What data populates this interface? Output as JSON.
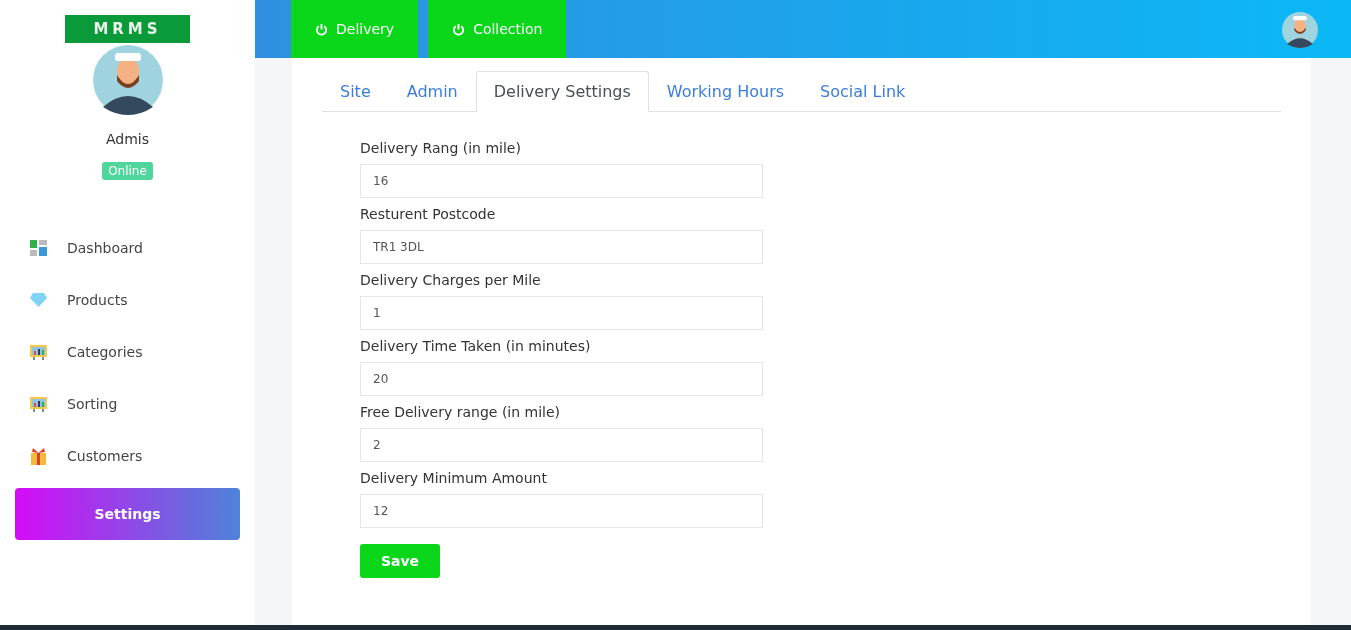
{
  "sidebar": {
    "logo": "MRMS",
    "user": {
      "name": "Admis",
      "status": "Online"
    },
    "items": [
      {
        "label": "Dashboard",
        "kind": "dashboard",
        "selected": false
      },
      {
        "label": "Products",
        "kind": "gem",
        "selected": false
      },
      {
        "label": "Categories",
        "kind": "chart",
        "selected": false
      },
      {
        "label": "Sorting",
        "kind": "chart",
        "selected": false
      },
      {
        "label": "Customers",
        "kind": "gift",
        "selected": false
      },
      {
        "label": "Settings",
        "selected": true
      }
    ]
  },
  "topbar": {
    "toggles": [
      {
        "label": "Delivery",
        "on": true
      },
      {
        "label": "Collection",
        "on": true
      }
    ]
  },
  "tabs": [
    {
      "label": "Site",
      "selected": false
    },
    {
      "label": "Admin",
      "selected": false
    },
    {
      "label": "Delivery Settings",
      "selected": true
    },
    {
      "label": "Working Hours",
      "selected": false
    },
    {
      "label": "Social Link",
      "selected": false
    }
  ],
  "form": {
    "fields": [
      {
        "label": "Delivery Rang (in mile)",
        "value": "16"
      },
      {
        "label": "Resturent Postcode",
        "value": "TR1 3DL"
      },
      {
        "label": "Delivery Charges per Mile",
        "value": "1"
      },
      {
        "label": "Delivery Time Taken (in minutes)",
        "value": "20"
      },
      {
        "label": "Free Delivery range (in mile)",
        "value": "2"
      },
      {
        "label": "Delivery Minimum Amount",
        "value": "12"
      }
    ],
    "submit": "Save"
  }
}
